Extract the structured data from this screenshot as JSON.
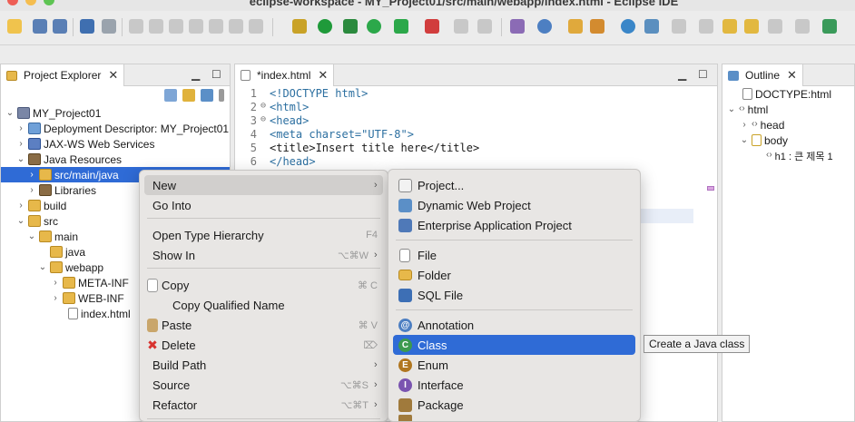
{
  "window": {
    "title": "eclipse-workspace - MY_Project01/src/main/webapp/index.html - Eclipse IDE"
  },
  "explorer": {
    "tab_label": "Project Explorer",
    "items": [
      {
        "label": "MY_Project01"
      },
      {
        "label": "Deployment Descriptor: MY_Project01"
      },
      {
        "label": "JAX-WS Web Services"
      },
      {
        "label": "Java Resources"
      },
      {
        "label": "src/main/java"
      },
      {
        "label": "Libraries"
      },
      {
        "label": "build"
      },
      {
        "label": "src"
      },
      {
        "label": "main"
      },
      {
        "label": "java"
      },
      {
        "label": "webapp"
      },
      {
        "label": "META-INF"
      },
      {
        "label": "WEB-INF"
      },
      {
        "label": "index.html"
      }
    ]
  },
  "editor": {
    "tab_label": "*index.html",
    "lines": [
      {
        "num": "1",
        "text": "<!DOCTYPE html>"
      },
      {
        "num": "2",
        "text": "<html>"
      },
      {
        "num": "3",
        "text": "<head>"
      },
      {
        "num": "4",
        "text": "<meta charset=\"UTF-8\">"
      },
      {
        "num": "5",
        "text": "<title>Insert title here</title>"
      },
      {
        "num": "6",
        "text": "</head>"
      }
    ]
  },
  "outline": {
    "tab_label": "Outline",
    "items": [
      {
        "label": "DOCTYPE:html"
      },
      {
        "label": "html"
      },
      {
        "label": "head"
      },
      {
        "label": "body"
      },
      {
        "label": "h1 : 큰 제목 1"
      }
    ]
  },
  "context_menu": {
    "items": [
      {
        "label": "New",
        "shortcut": ""
      },
      {
        "label": "Go Into",
        "shortcut": ""
      },
      {
        "label": "Open Type Hierarchy",
        "shortcut": "F4"
      },
      {
        "label": "Show In",
        "shortcut": "⌥⌘W"
      },
      {
        "label": "Copy",
        "shortcut": "⌘ C"
      },
      {
        "label": "Copy Qualified Name",
        "shortcut": ""
      },
      {
        "label": "Paste",
        "shortcut": "⌘ V"
      },
      {
        "label": "Delete",
        "shortcut": "⌦"
      },
      {
        "label": "Build Path",
        "shortcut": ""
      },
      {
        "label": "Source",
        "shortcut": "⌥⌘S"
      },
      {
        "label": "Refactor",
        "shortcut": "⌥⌘T"
      }
    ]
  },
  "new_submenu": {
    "items": [
      {
        "label": "Project..."
      },
      {
        "label": "Dynamic Web Project"
      },
      {
        "label": "Enterprise Application Project"
      },
      {
        "label": "File"
      },
      {
        "label": "Folder"
      },
      {
        "label": "SQL File"
      },
      {
        "label": "Annotation"
      },
      {
        "label": "Class"
      },
      {
        "label": "Enum"
      },
      {
        "label": "Interface"
      },
      {
        "label": "Package"
      }
    ]
  },
  "tooltip": {
    "text": "Create a Java class"
  },
  "colors": {
    "selection": "#2f6bd6",
    "menu_bg": "#e8e6e4"
  }
}
